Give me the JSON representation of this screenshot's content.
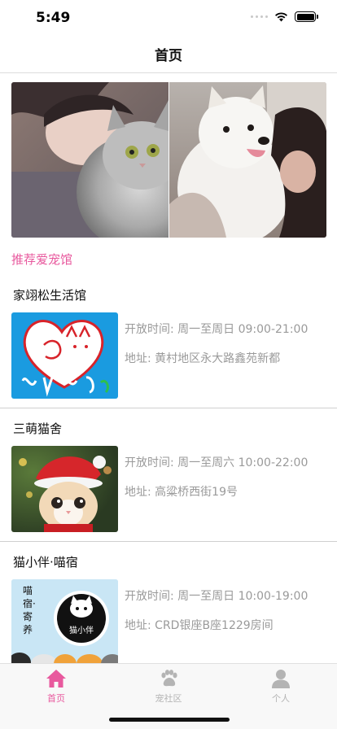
{
  "status": {
    "time": "5:49"
  },
  "nav": {
    "title": "首页"
  },
  "section_title": "推荐爱宠馆",
  "shops": [
    {
      "name": "家翊松生活馆",
      "hours": "开放时间: 周一至周日 09:00-21:00",
      "address": "地址: 黄村地区永大路鑫苑新都"
    },
    {
      "name": "三萌猫舍",
      "hours": "开放时间: 周一至周六 10:00-22:00",
      "address": "地址: 高粱桥西街19号"
    },
    {
      "name": "猫小伴·喵宿",
      "hours": "开放时间: 周一至周日 10:00-19:00",
      "address": "地址: CRD银座B座1229房间"
    }
  ],
  "logo_text": {
    "shop3_left": "喵宿·寄养",
    "shop3_badge": "猫小伴"
  },
  "tabs": [
    {
      "label": "首页",
      "icon": "home-icon",
      "active": true
    },
    {
      "label": "宠社区",
      "icon": "paw-icon",
      "active": false
    },
    {
      "label": "个人",
      "icon": "person-icon",
      "active": false
    }
  ],
  "colors": {
    "accent": "#e8599e",
    "inactive": "#b4b4b4",
    "muted_text": "#9a9a9a"
  }
}
